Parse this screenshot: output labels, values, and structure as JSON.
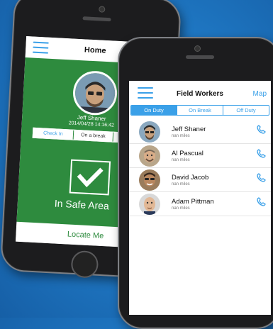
{
  "back_screen": {
    "title": "Home",
    "user_name": "Jeff Shaner",
    "timestamp": "2014/04/28 14:16:42",
    "status_tabs": [
      "Check In",
      "On a break",
      "C"
    ],
    "active_status": "Check In",
    "status_text": "In Safe Area",
    "locate_button": "Locate Me",
    "accent_color": "#2e8b3e"
  },
  "front_screen": {
    "title": "Field Workers",
    "map_link": "Map",
    "segments": [
      "On Duty",
      "On Break",
      "Off Duty"
    ],
    "active_segment": "On Duty",
    "accent_color": "#3aa0e8",
    "workers": [
      {
        "name": "Jeff Shaner",
        "distance": "nan miles"
      },
      {
        "name": "Al Pascual",
        "distance": "nan miles"
      },
      {
        "name": "David Jacob",
        "distance": "nan miles"
      },
      {
        "name": "Adam Pittman",
        "distance": "nan miles"
      }
    ]
  }
}
